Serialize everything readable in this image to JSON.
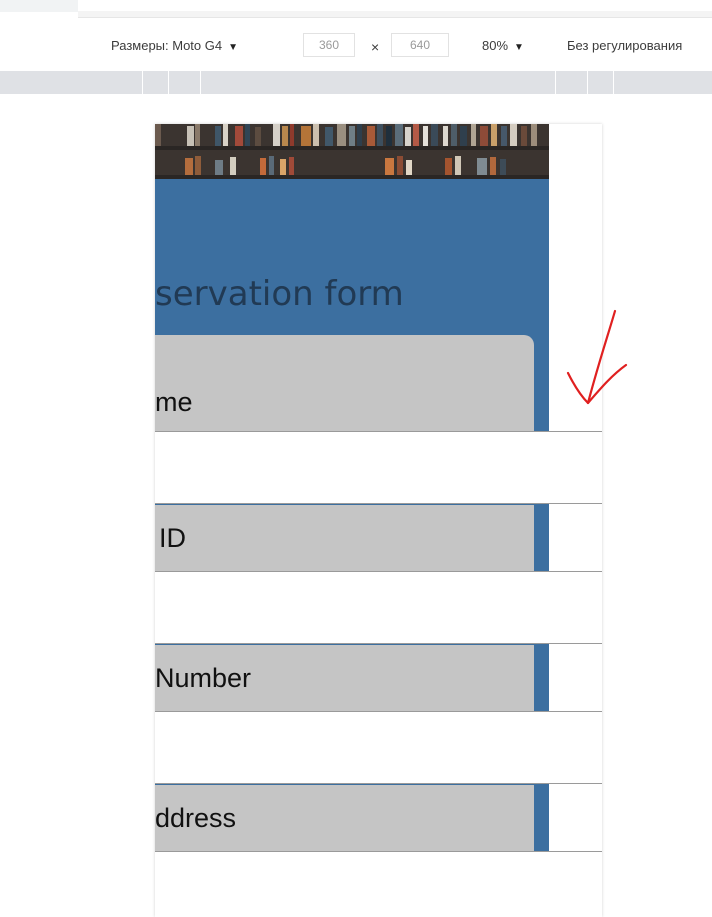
{
  "devtools": {
    "dimensions_label": "Размеры: Moto G4",
    "width_value": "360",
    "times_symbol": "×",
    "height_value": "640",
    "zoom_label": "80%",
    "throttle_label": "Без регулирования"
  },
  "page": {
    "form_title": "servation form",
    "fields": [
      {
        "label": "me",
        "value": ""
      },
      {
        "label": "ID",
        "value": ""
      },
      {
        "label": "Number",
        "value": ""
      },
      {
        "label": "ddress",
        "value": ""
      }
    ]
  },
  "colors": {
    "header_blue": "#3c6fa0",
    "label_gray": "#c5c5c5",
    "title_color": "#213a54",
    "annotation_red": "#e02020"
  },
  "icons": {
    "dropdown": "caret-down-icon",
    "annotation": "hand-drawn-arrow-icon"
  }
}
